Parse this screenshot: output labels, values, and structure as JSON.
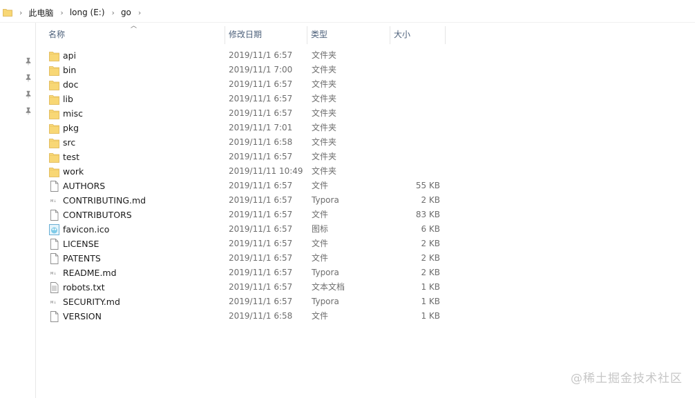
{
  "breadcrumb": {
    "items": [
      "此电脑",
      "long (E:)",
      "go"
    ],
    "separator": "›"
  },
  "columns": {
    "name": "名称",
    "date": "修改日期",
    "type": "类型",
    "size": "大小"
  },
  "files": [
    {
      "name": "api",
      "date": "2019/11/1 6:57",
      "type": "文件夹",
      "size": "",
      "icon": "folder-icon"
    },
    {
      "name": "bin",
      "date": "2019/11/1 7:00",
      "type": "文件夹",
      "size": "",
      "icon": "folder-icon"
    },
    {
      "name": "doc",
      "date": "2019/11/1 6:57",
      "type": "文件夹",
      "size": "",
      "icon": "folder-icon"
    },
    {
      "name": "lib",
      "date": "2019/11/1 6:57",
      "type": "文件夹",
      "size": "",
      "icon": "folder-icon"
    },
    {
      "name": "misc",
      "date": "2019/11/1 6:57",
      "type": "文件夹",
      "size": "",
      "icon": "folder-icon"
    },
    {
      "name": "pkg",
      "date": "2019/11/1 7:01",
      "type": "文件夹",
      "size": "",
      "icon": "folder-icon"
    },
    {
      "name": "src",
      "date": "2019/11/1 6:58",
      "type": "文件夹",
      "size": "",
      "icon": "folder-icon"
    },
    {
      "name": "test",
      "date": "2019/11/1 6:57",
      "type": "文件夹",
      "size": "",
      "icon": "folder-icon"
    },
    {
      "name": "work",
      "date": "2019/11/11 10:49",
      "type": "文件夹",
      "size": "",
      "icon": "folder-icon"
    },
    {
      "name": "AUTHORS",
      "date": "2019/11/1 6:57",
      "type": "文件",
      "size": "55 KB",
      "icon": "file-icon"
    },
    {
      "name": "CONTRIBUTING.md",
      "date": "2019/11/1 6:57",
      "type": "Typora",
      "size": "2 KB",
      "icon": "markdown-file-icon"
    },
    {
      "name": "CONTRIBUTORS",
      "date": "2019/11/1 6:57",
      "type": "文件",
      "size": "83 KB",
      "icon": "file-icon"
    },
    {
      "name": "favicon.ico",
      "date": "2019/11/1 6:57",
      "type": "图标",
      "size": "6 KB",
      "icon": "gopher-ico-icon"
    },
    {
      "name": "LICENSE",
      "date": "2019/11/1 6:57",
      "type": "文件",
      "size": "2 KB",
      "icon": "file-icon"
    },
    {
      "name": "PATENTS",
      "date": "2019/11/1 6:57",
      "type": "文件",
      "size": "2 KB",
      "icon": "file-icon"
    },
    {
      "name": "README.md",
      "date": "2019/11/1 6:57",
      "type": "Typora",
      "size": "2 KB",
      "icon": "markdown-file-icon"
    },
    {
      "name": "robots.txt",
      "date": "2019/11/1 6:57",
      "type": "文本文档",
      "size": "1 KB",
      "icon": "text-file-icon"
    },
    {
      "name": "SECURITY.md",
      "date": "2019/11/1 6:57",
      "type": "Typora",
      "size": "1 KB",
      "icon": "markdown-file-icon"
    },
    {
      "name": "VERSION",
      "date": "2019/11/1 6:58",
      "type": "文件",
      "size": "1 KB",
      "icon": "file-icon"
    }
  ],
  "watermark": "@稀土掘金技术社区",
  "colors": {
    "folder": "#f8d775",
    "header_text": "#4c607a",
    "meta_text": "#6d6d6d"
  }
}
